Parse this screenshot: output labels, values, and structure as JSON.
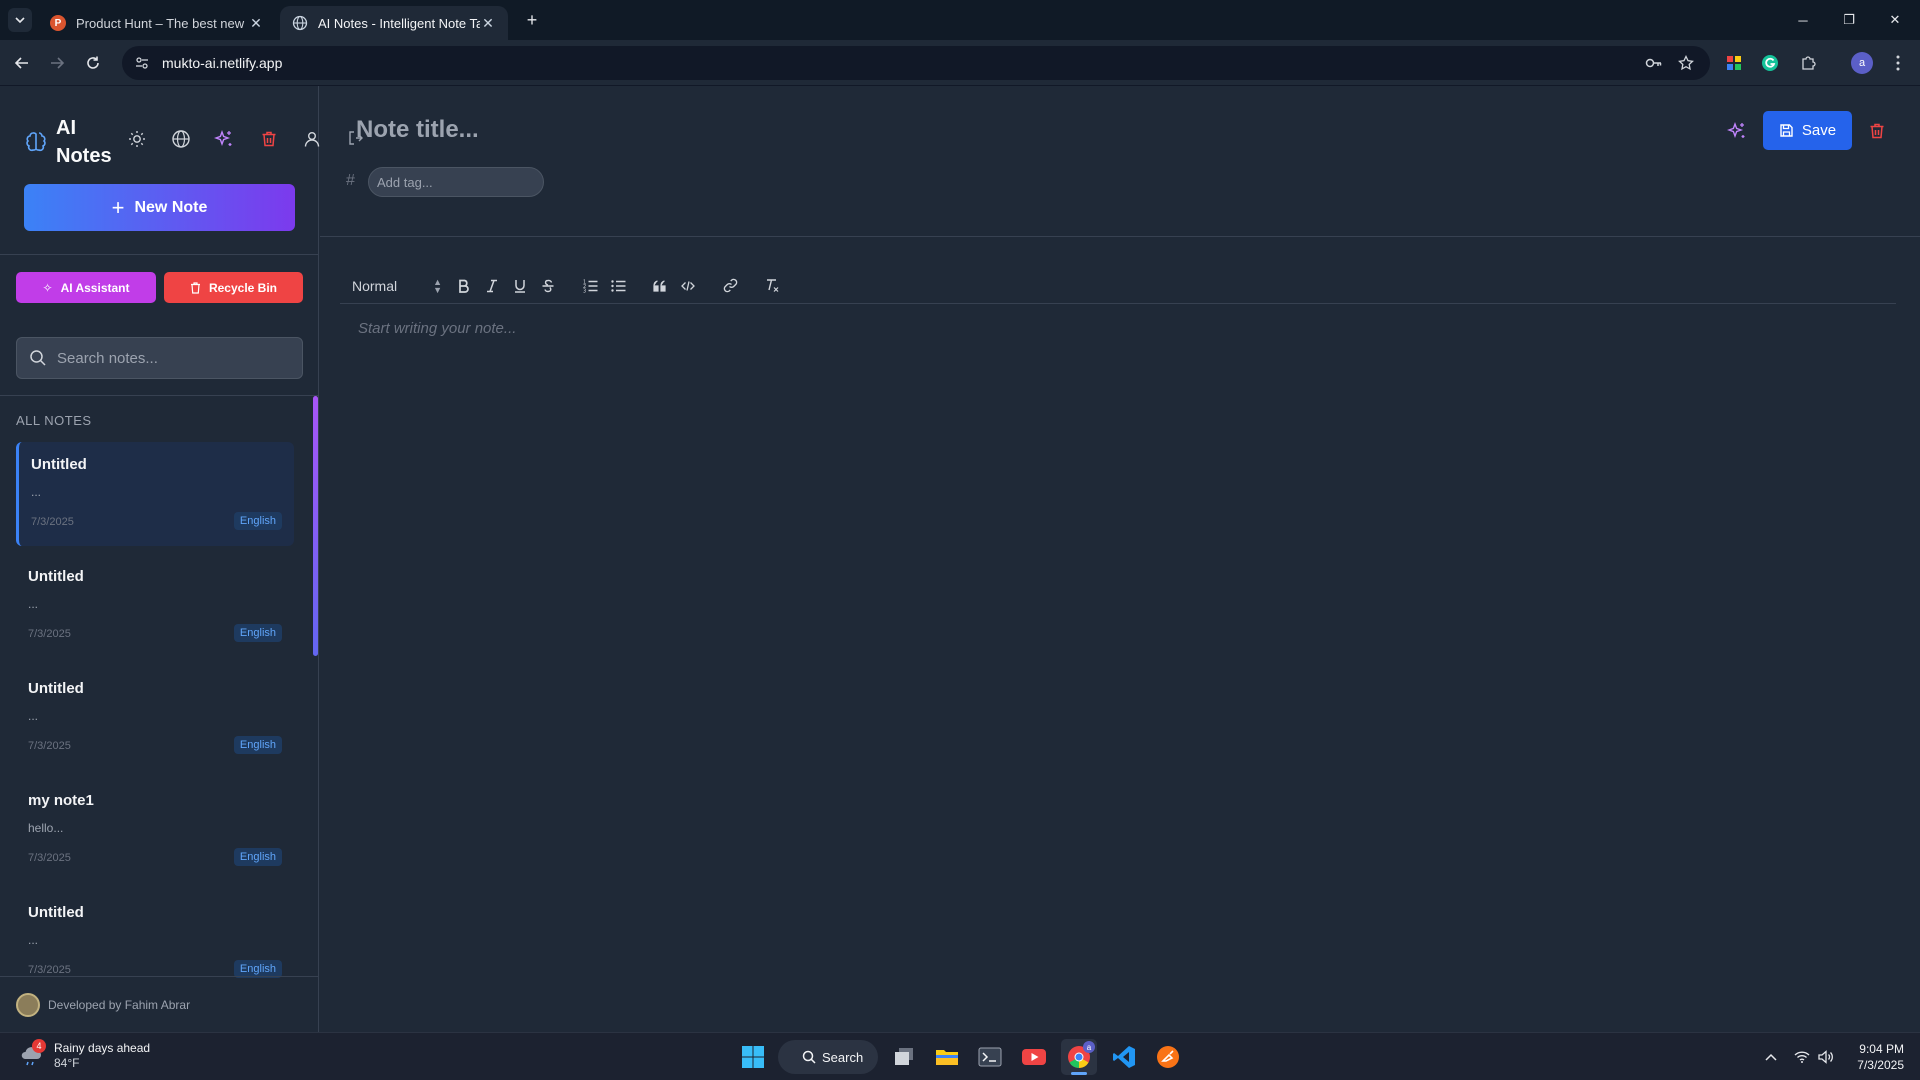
{
  "browser": {
    "tabs": [
      {
        "title": "Product Hunt – The best new p",
        "favicon": "P"
      },
      {
        "title": "AI Notes - Intelligent Note Taki",
        "favicon": "globe-icon"
      }
    ],
    "url": "mukto-ai.netlify.app",
    "profile_initial": "a"
  },
  "sidebar": {
    "brand": "AI Notes",
    "new_note_label": "New Note",
    "ai_assistant_label": "AI Assistant",
    "recycle_bin_label": "Recycle Bin",
    "search_placeholder": "Search notes...",
    "section_label": "ALL NOTES",
    "notes": [
      {
        "title": "Untitled",
        "preview": "...",
        "date": "7/3/2025",
        "language": "English",
        "active": true
      },
      {
        "title": "Untitled",
        "preview": "...",
        "date": "7/3/2025",
        "language": "English",
        "active": false
      },
      {
        "title": "Untitled",
        "preview": "...",
        "date": "7/3/2025",
        "language": "English",
        "active": false
      },
      {
        "title": "my note1",
        "preview": "hello...",
        "date": "7/3/2025",
        "language": "English",
        "active": false
      },
      {
        "title": "Untitled",
        "preview": "...",
        "date": "7/3/2025",
        "language": "English",
        "active": false
      }
    ],
    "footer_text": "Developed by Fahim Abrar"
  },
  "editor": {
    "title_placeholder": "Note title...",
    "tag_placeholder": "Add tag...",
    "save_label": "Save",
    "format_value": "Normal",
    "body_placeholder": "Start writing your note..."
  },
  "taskbar": {
    "weather_title": "Rainy days ahead",
    "weather_temp": "84°F",
    "weather_badge": "4",
    "search_label": "Search",
    "time": "9:04 PM",
    "date": "7/3/2025"
  },
  "colors": {
    "accent": "#2563eb",
    "new_note_gradient": [
      "#3b82f6",
      "#7c3aed"
    ],
    "ai_assistant": "#c13de8",
    "recycle_bin": "#ef4444"
  }
}
